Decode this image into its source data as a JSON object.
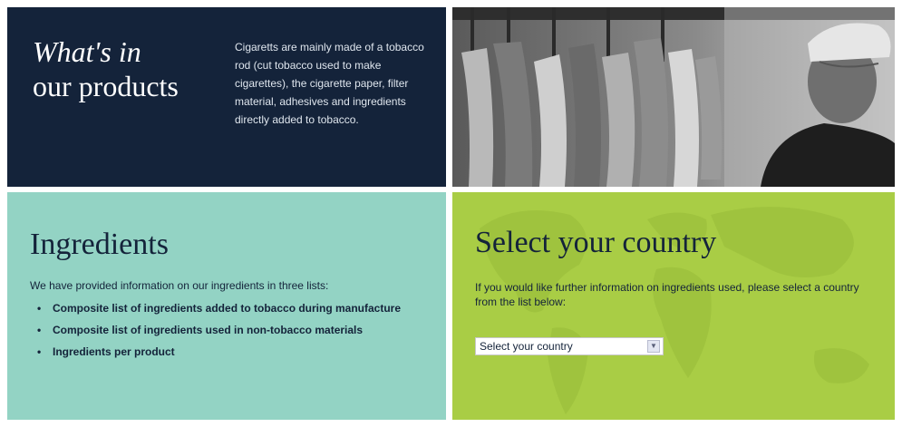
{
  "intro": {
    "title_line1": "What's in",
    "title_line2": "our products",
    "body": "Cigaretts are mainly made of a tobacco rod (cut tobacco used to make cigarettes), the cigarette paper, filter material, adhesives and ingredients directly added to tobacco."
  },
  "photo": {
    "icon": "tobacco-leaves-farmer-photo"
  },
  "ingredients": {
    "title": "Ingredients",
    "intro": "We have provided information on our ingredients in three lists:",
    "items": [
      "Composite list of ingredients added to tobacco during manufacture",
      "Composite list of ingredients used in non-tobacco materials",
      "Ingredients per product"
    ]
  },
  "country": {
    "title": "Select your country",
    "text": "If you would like further information on ingredients used, please select a country from the list below:",
    "select_value": "Select your country"
  },
  "colors": {
    "navy": "#14233a",
    "teal": "#93d3c4",
    "lime": "#a9cd45"
  }
}
